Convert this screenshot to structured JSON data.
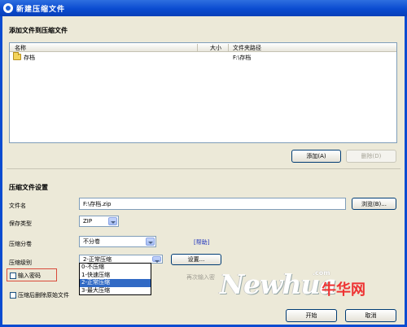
{
  "window": {
    "title": "新建压缩文件"
  },
  "add_section": {
    "title": "添加文件到压缩文件",
    "columns": [
      "名称",
      "大小",
      "文件夹路径"
    ],
    "rows": [
      {
        "name": "存档",
        "size": "",
        "path": "F:\\存档"
      }
    ],
    "add_button": "添加(A)",
    "remove_button": "删除(D)"
  },
  "settings": {
    "title": "压缩文件设置",
    "filename_label": "文件名",
    "filename_value": "F:\\存档.zip",
    "browse_button": "浏览(B)...",
    "type_label": "保存类型",
    "type_value": "ZIP",
    "split_label": "压缩分卷",
    "split_value": "不分卷",
    "help_link": "[帮助]",
    "level_label": "压缩级别",
    "level_value": "2-正常压缩",
    "level_options": [
      "0-不压缩",
      "1-快速压缩",
      "2-正常压缩",
      "3-最大压缩"
    ],
    "level_selected_index": 2,
    "settings_button": "设置...",
    "password_label": "输入密码",
    "confirm_password_hint": "再次输入密",
    "delete_after_label": "压缩后删除原始文件"
  },
  "watermark": {
    "brand": "Newhua",
    "dotcom": ".com",
    "cn": "牛华网"
  },
  "footer": {
    "ok_button": "开始",
    "cancel_button": "取消"
  }
}
